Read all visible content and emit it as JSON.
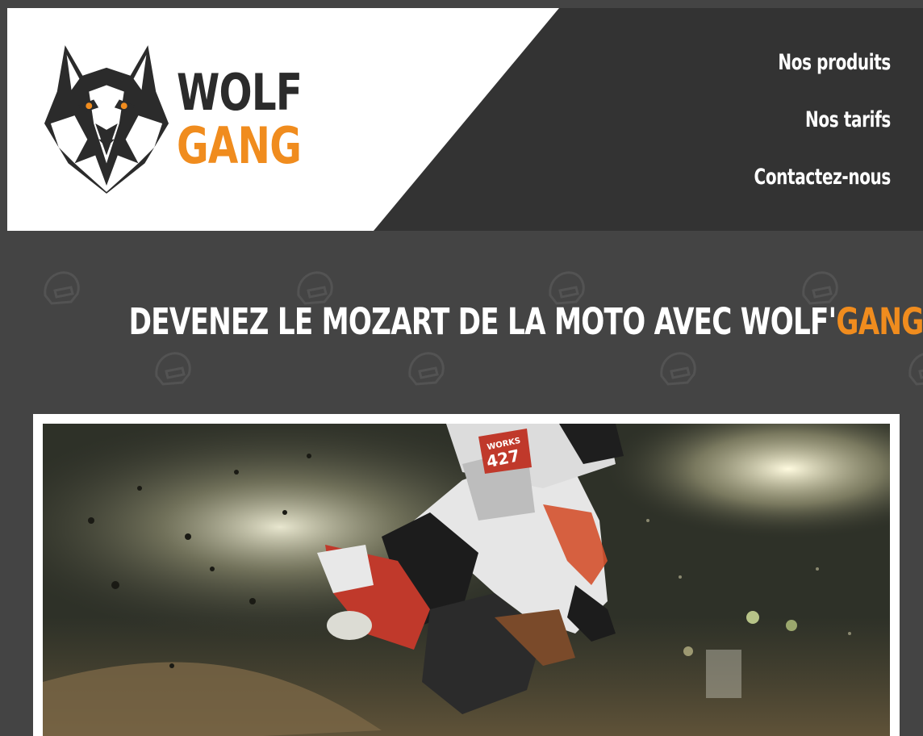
{
  "logo": {
    "line1": "WOLF",
    "line2": "GANG",
    "icon": "wolf-head-icon"
  },
  "nav": {
    "items": [
      {
        "label": "Nos produits"
      },
      {
        "label": "Nos tarifs"
      },
      {
        "label": "Contactez-nous"
      }
    ]
  },
  "hero": {
    "headline_main": "DEVENEZ LE MOZART DE LA MOTO AVEC WOLF'",
    "headline_accent": "GANG",
    "headline_end": " !",
    "background_pattern_icon": "helmet-icon"
  },
  "photo": {
    "icon": "motocross-rider-photo",
    "bib_text": "WORKS",
    "bib_number": "427"
  },
  "colors": {
    "accent": "#f08c1e",
    "header_dark": "#333333",
    "background": "#444444",
    "text_light": "#ffffff",
    "logo_dark": "#2b2b2b"
  }
}
